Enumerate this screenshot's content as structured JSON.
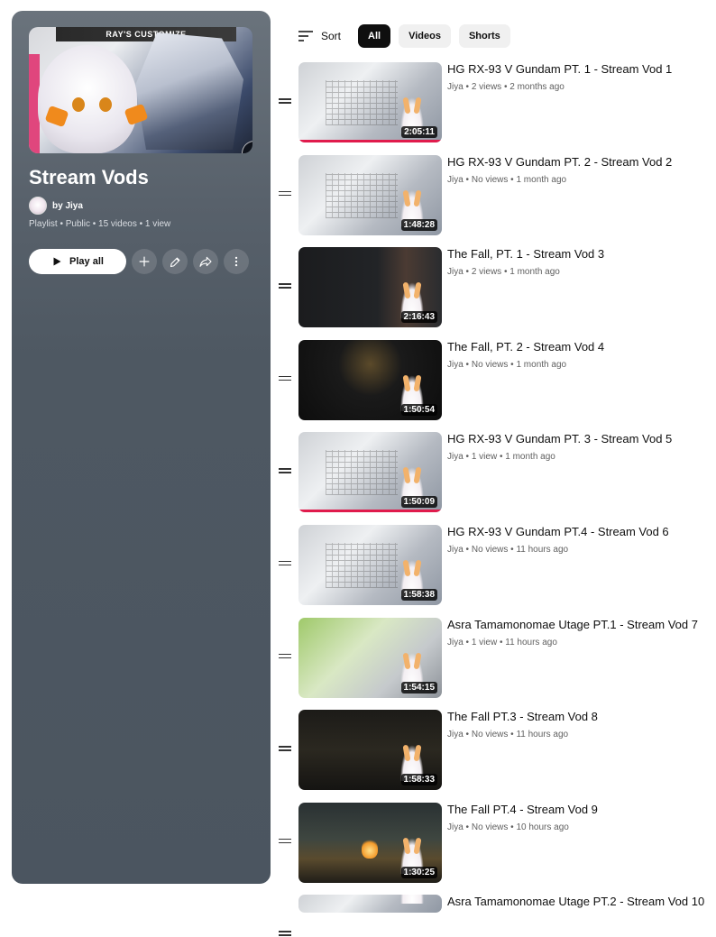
{
  "playlist": {
    "title": "Stream Vods",
    "owner": "by Jiya",
    "meta": "Playlist • Public • 15 videos • 1 view",
    "cover_banner": "RAY'S CUSTOMIZE",
    "play_all_label": "Play all"
  },
  "filters": {
    "sort_label": "Sort",
    "chips": [
      "All",
      "Videos",
      "Shorts"
    ],
    "selected": "All"
  },
  "videos": [
    {
      "title": "HG RX-93 V Gundam PT. 1 - Stream Vod 1",
      "meta": "Jiya • 2 views • 2 months ago",
      "duration": "2:05:11",
      "thumb": "gundam",
      "progress": 1.0
    },
    {
      "title": "HG RX-93 V Gundam PT. 2 - Stream Vod 2",
      "meta": "Jiya • No views • 1 month ago",
      "duration": "1:48:28",
      "thumb": "gundam",
      "progress": 0
    },
    {
      "title": "The Fall, PT. 1 - Stream Vod 3",
      "meta": "Jiya • 2 views • 1 month ago",
      "duration": "2:16:43",
      "thumb": "fall1",
      "progress": 0
    },
    {
      "title": "The Fall, PT. 2 - Stream Vod 4",
      "meta": "Jiya • No views • 1 month ago",
      "duration": "1:50:54",
      "thumb": "fall2",
      "progress": 0
    },
    {
      "title": "HG RX-93 V Gundam PT. 3 - Stream Vod 5",
      "meta": "Jiya • 1 view • 1 month ago",
      "duration": "1:50:09",
      "thumb": "gundam",
      "progress": 1.0
    },
    {
      "title": "HG RX-93 V Gundam PT.4 - Stream Vod 6",
      "meta": "Jiya • No views • 11 hours ago",
      "duration": "1:58:38",
      "thumb": "gundam",
      "progress": 0
    },
    {
      "title": "Asra Tamamonomae Utage PT.1 - Stream Vod 7",
      "meta": "Jiya • 1 view • 11 hours ago",
      "duration": "1:54:15",
      "thumb": "green",
      "progress": 0
    },
    {
      "title": "The Fall PT.3 - Stream Vod 8",
      "meta": "Jiya • No views • 11 hours ago",
      "duration": "1:58:33",
      "thumb": "dark",
      "progress": 0
    },
    {
      "title": "The Fall PT.4 - Stream Vod 9",
      "meta": "Jiya • No views • 10 hours ago",
      "duration": "1:30:25",
      "thumb": "fire",
      "progress": 0
    },
    {
      "title": "Asra Tamamonomae Utage PT.2 - Stream Vod 10",
      "meta": "",
      "duration": "",
      "thumb": "gundam",
      "progress": 0,
      "partial": true
    }
  ],
  "icons": {
    "sort": "sort-lines-icon",
    "play": "play-icon",
    "add": "plus-icon",
    "edit": "pencil-icon",
    "share": "share-arrow-icon",
    "more": "more-vert-icon",
    "drag": "drag-handle-icon"
  }
}
